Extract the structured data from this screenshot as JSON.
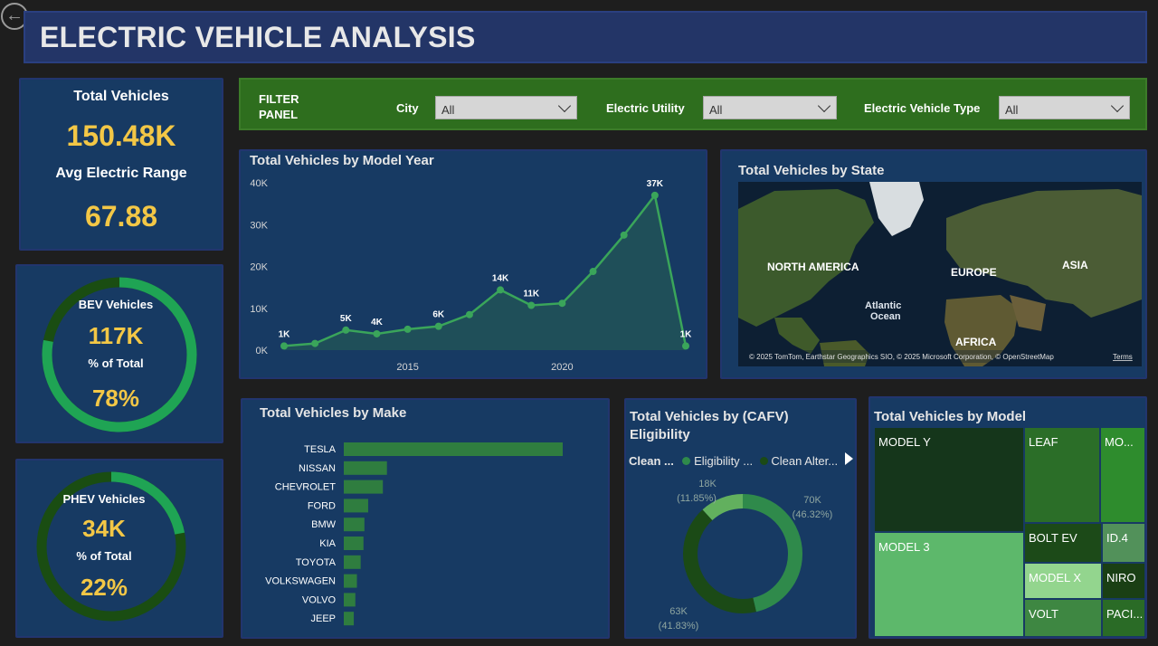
{
  "header": {
    "title": "ELECTRIC VEHICLE ANALYSIS"
  },
  "kpi_total": {
    "label1": "Total Vehicles",
    "value1": "150.48K",
    "label2": "Avg Electric Range",
    "value2": "67.88"
  },
  "kpi_bev": {
    "label": "BEV Vehicles",
    "value": "117K",
    "pct_label": "% of Total",
    "pct": "78%",
    "fraction": 0.78
  },
  "kpi_phev": {
    "label": "PHEV Vehicles",
    "value": "34K",
    "pct_label": "% of Total",
    "pct": "22%",
    "fraction": 0.22
  },
  "filters": {
    "panel_label": "FILTER PANEL",
    "city": {
      "label": "City",
      "value": "All"
    },
    "utility": {
      "label": "Electric Utility",
      "value": "All"
    },
    "ev_type": {
      "label": "Electric Vehicle Type",
      "value": "All"
    }
  },
  "colors": {
    "accent_yellow": "#f3c746",
    "green": "#3aa55a",
    "dark_green": "#1a4d12",
    "card": "#173a63"
  },
  "map": {
    "title": "Total Vehicles by State",
    "labels": [
      "NORTH AMERICA",
      "EUROPE",
      "ASIA",
      "Atlantic",
      "Ocean",
      "AFRICA"
    ],
    "attribution": "© 2025 TomTom, Earthstar Geographics SIO, © 2025 Microsoft Corporation, © OpenStreetMap",
    "terms": "Terms"
  },
  "chart_data": [
    {
      "type": "area",
      "title": "Total Vehicles by Model Year",
      "x": [
        2011,
        2012,
        2013,
        2014,
        2015,
        2016,
        2017,
        2018,
        2019,
        2020,
        2021,
        2022,
        2023,
        2024
      ],
      "values": [
        1000,
        1600,
        4800,
        3900,
        5000,
        5700,
        8500,
        14400,
        10700,
        11200,
        18800,
        27500,
        37000,
        1000
      ],
      "data_labels": [
        "1K",
        "",
        "5K",
        "4K",
        "",
        "6K",
        "",
        "14K",
        "11K",
        "",
        "",
        "",
        "37K",
        "1K"
      ],
      "x_ticks": [
        "2015",
        "2020"
      ],
      "y_ticks": [
        "0K",
        "10K",
        "20K",
        "30K",
        "40K"
      ],
      "ylim": [
        0,
        40000
      ]
    },
    {
      "type": "bar",
      "title": "Total Vehicles by Make",
      "categories": [
        "TESLA",
        "NISSAN",
        "CHEVROLET",
        "FORD",
        "BMW",
        "KIA",
        "TOYOTA",
        "VOLKSWAGEN",
        "VOLVO",
        "JEEP"
      ],
      "values": [
        70000,
        13800,
        12500,
        7800,
        6600,
        6300,
        5400,
        4200,
        3700,
        3200
      ]
    },
    {
      "type": "pie",
      "title": "Total Vehicles by (CAFV) Eligibility",
      "legend": [
        "Clean ...",
        "Eligibility ...",
        "Clean Alter..."
      ],
      "slices": [
        {
          "value_label": "70K",
          "pct_label": "(46.32%)",
          "pct": 46.32,
          "color": "#2f8a4b"
        },
        {
          "value_label": "63K",
          "pct_label": "(41.83%)",
          "pct": 41.83,
          "color": "#1b4a16"
        },
        {
          "value_label": "18K",
          "pct_label": "(11.85%)",
          "pct": 11.85,
          "color": "#62b05e"
        }
      ]
    },
    {
      "type": "treemap",
      "title": "Total Vehicles by Model",
      "labels": [
        "MODEL Y",
        "MODEL 3",
        "LEAF",
        "MO...",
        "BOLT EV",
        "ID.4",
        "MODEL X",
        "NIRO",
        "VOLT",
        "PACI..."
      ]
    }
  ]
}
